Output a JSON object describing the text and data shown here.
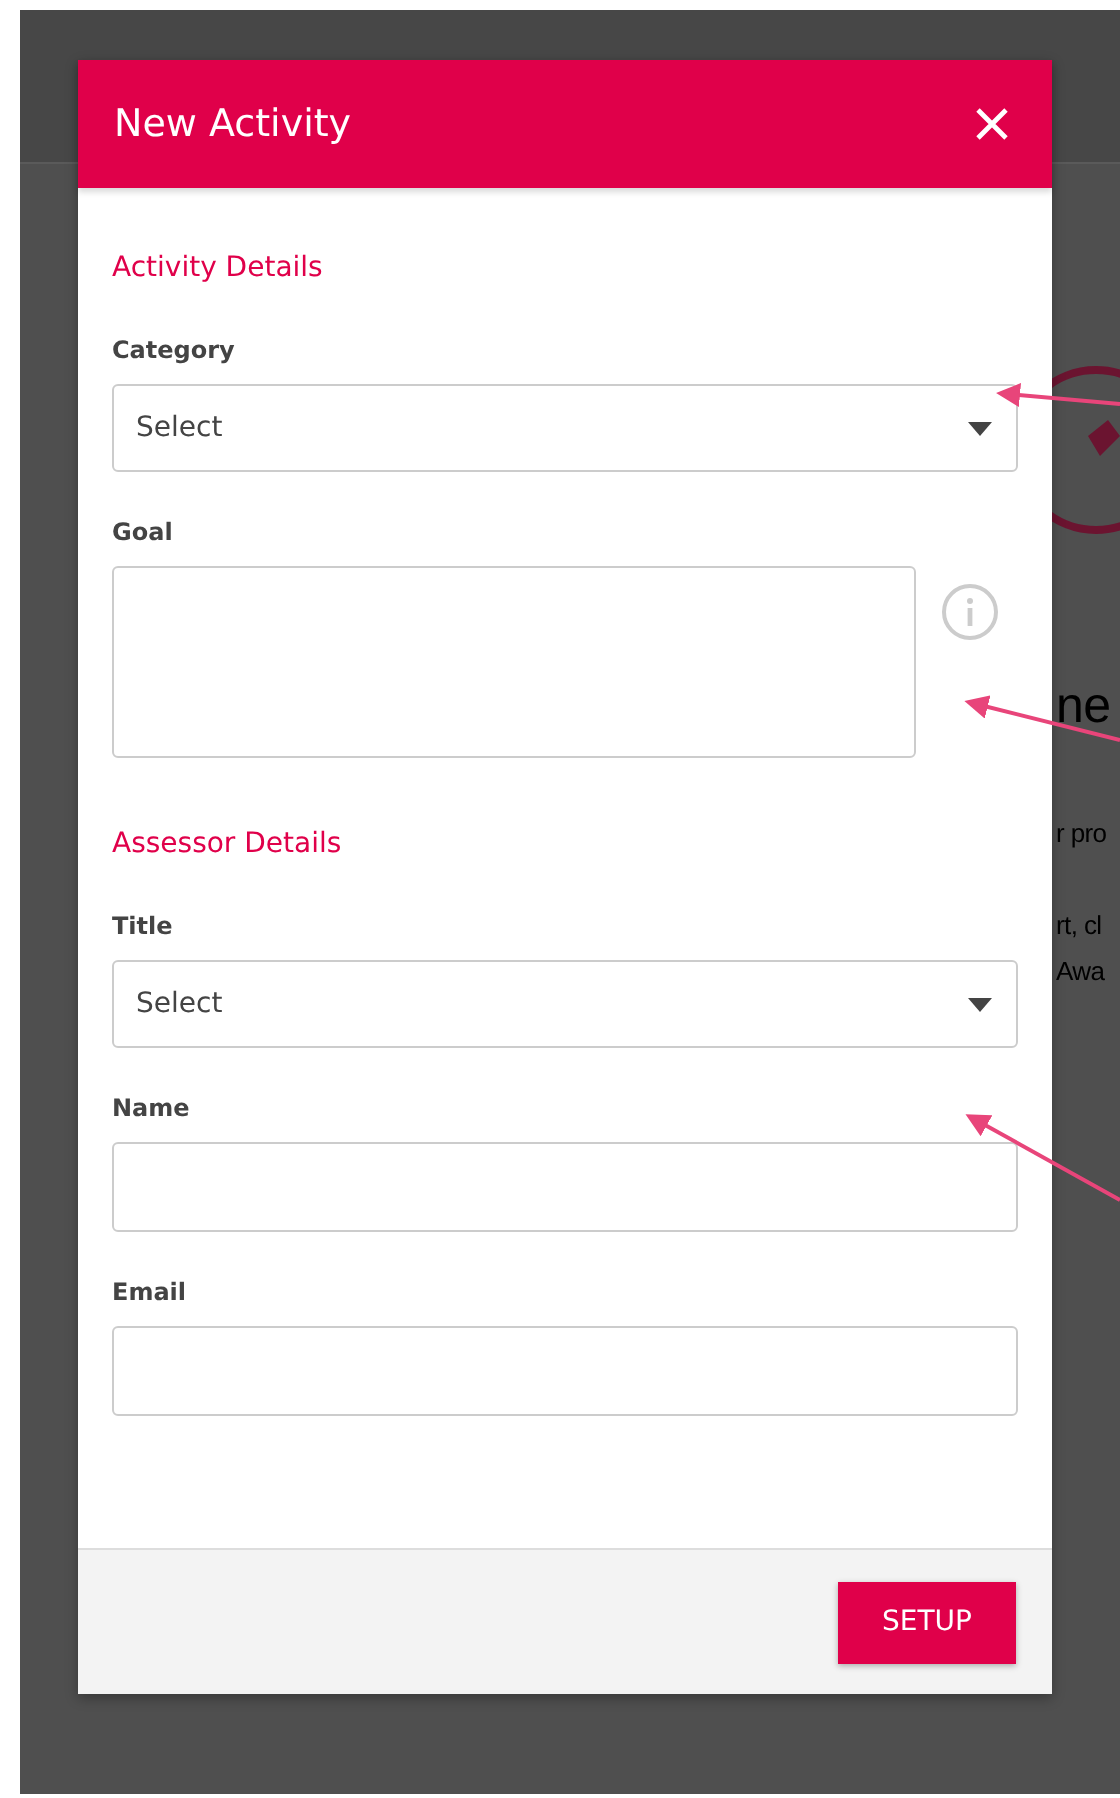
{
  "dialog": {
    "title": "New Activity",
    "sections": [
      {
        "heading": "Activity Details",
        "fields": [
          {
            "kind": "select",
            "label": "Category",
            "value": "Select"
          },
          {
            "kind": "textarea",
            "label": "Goal",
            "info": true
          }
        ]
      },
      {
        "heading": "Assessor Details",
        "fields": [
          {
            "kind": "select",
            "label": "Title",
            "value": "Select"
          },
          {
            "kind": "text",
            "label": "Name"
          },
          {
            "kind": "text",
            "label": "Email"
          }
        ]
      }
    ],
    "button": "SETUP"
  },
  "background_texts": [
    "ne",
    "r pro",
    "rt, cl",
    "Awa"
  ]
}
